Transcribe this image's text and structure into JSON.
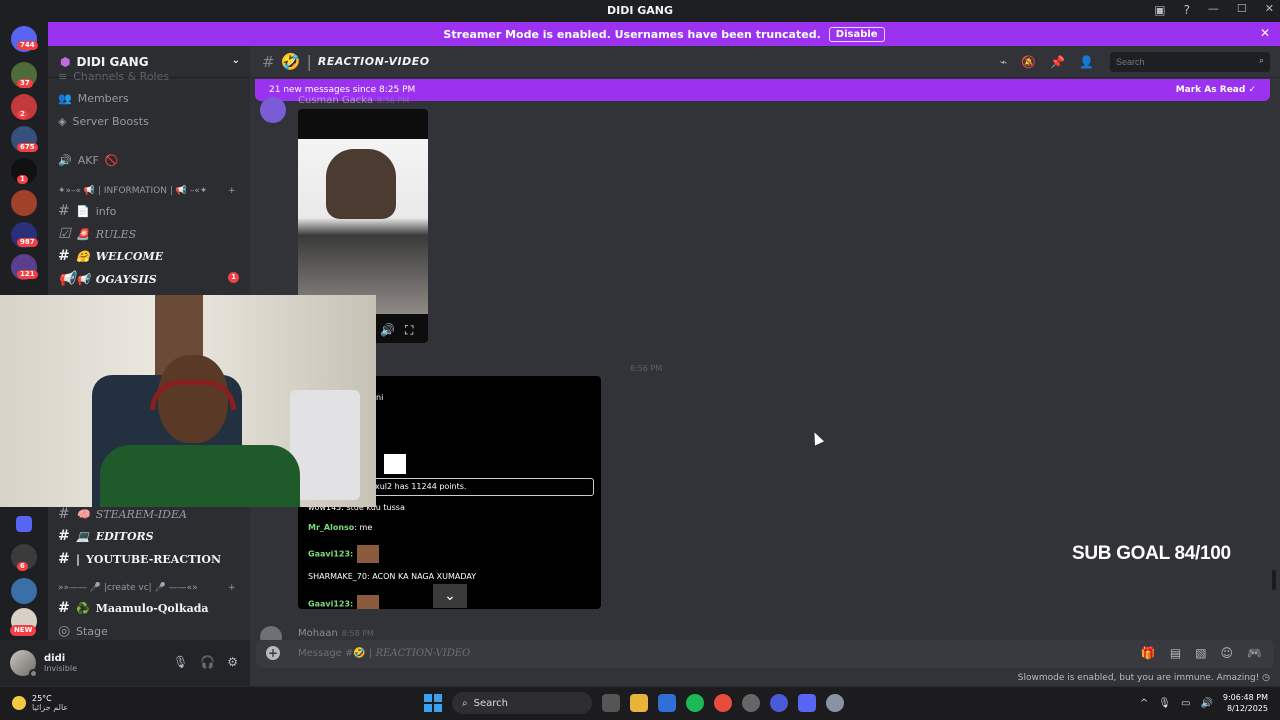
{
  "window": {
    "title": "DIDI GANG"
  },
  "banner": {
    "text": "Streamer Mode is enabled. Usernames have been truncated.",
    "disable_label": "Disable"
  },
  "server_badges": [
    "744",
    "37",
    "2",
    "675",
    "1",
    "987",
    "121",
    "6"
  ],
  "server_new_label": "NEW",
  "guild": {
    "name": "DIDI GANG"
  },
  "sidebar": {
    "top_cut": "Channels & Roles",
    "members": "Members",
    "boosts": "Server Boosts",
    "voice_akf": "AKF",
    "category_info": "✦»–« 📢 | INFORMATION | 📢 –«✦",
    "channels": [
      {
        "emoji": "📄",
        "name": "info"
      },
      {
        "emoji": "🚨",
        "name": "RULES"
      },
      {
        "emoji": "🤗",
        "name": "WELCOME"
      },
      {
        "emoji": "📢",
        "name": "OGAYSIIS",
        "badge": "1"
      }
    ],
    "lower_channels": [
      {
        "emoji": "🧠",
        "name": "STEAREM-IDEA"
      },
      {
        "emoji": "💻",
        "name": "EDITORS"
      },
      {
        "emoji": "",
        "name": "YOUTUBE-REACTION"
      }
    ],
    "category_vc": "»»—— 🎤 |create vc| 🎤 ——«»",
    "vc_channel": {
      "emoji": "♻️",
      "name": "Maamulo-Qolkada"
    },
    "stage": "Stage"
  },
  "user": {
    "name": "didi",
    "status": "Invisible"
  },
  "channel": {
    "name": "REACTION-VIDEO",
    "search_placeholder": "Search"
  },
  "new_messages": {
    "text": "21 new messages since 8:25 PM",
    "mark_label": "Mark As Read"
  },
  "messages": {
    "first_author": "Cusman Gacka",
    "first_time": "8:56 PM",
    "second_time": "8:56 PM",
    "last_author": "Mohaan",
    "last_time": "8:58 PM"
  },
  "embed": {
    "line_ni": "ni",
    "points": "xul2 has 11244 points.",
    "line1": "wow143: stue kuu tussa",
    "line2_user": "Mr_Alonso",
    "line2_text": ": me",
    "line3_user": "Gaavi123:",
    "line4": "SHARMAKE_70: ACON KA NAGA XUMADAY",
    "line5_user": "Gaavi123:"
  },
  "overlay": {
    "sub_goal": "SUB GOAL 84/100"
  },
  "composer": {
    "placeholder_prefix": "Message #",
    "channel": "REACTION-VIDEO"
  },
  "slowmode": "Slowmode is enabled, but you are immune. Amazing!",
  "taskbar": {
    "temp": "25°C",
    "weather_desc": "عالم جزائيا",
    "search_label": "Search",
    "time": "9:06:48 PM",
    "date": "8/12/2025"
  },
  "colors": {
    "accent": "#9b32f0",
    "bg": "#313338",
    "sidebar": "#2b2d31",
    "rail": "#1e1f22"
  }
}
